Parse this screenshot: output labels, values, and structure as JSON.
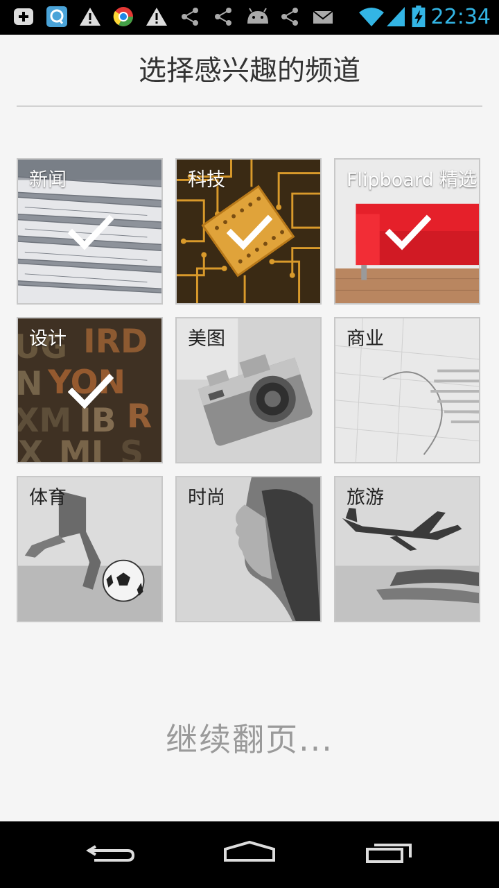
{
  "status_bar": {
    "time": "22:34",
    "icons": [
      "add-box-icon",
      "search-app-icon",
      "warning-icon",
      "chrome-like-icon",
      "warning-icon",
      "share-icon",
      "share-icon",
      "android-icon",
      "share-icon",
      "mail-icon",
      "wifi-icon",
      "signal-icon",
      "battery-charging-icon"
    ]
  },
  "header": {
    "title": "选择感兴趣的频道"
  },
  "channels": [
    {
      "label": "新闻",
      "selected": true
    },
    {
      "label": "科技",
      "selected": true
    },
    {
      "label": "Flipboard 精选",
      "selected": true
    },
    {
      "label": "设计",
      "selected": true
    },
    {
      "label": "美图",
      "selected": false
    },
    {
      "label": "商业",
      "selected": false
    },
    {
      "label": "体育",
      "selected": false
    },
    {
      "label": "时尚",
      "selected": false
    },
    {
      "label": "旅游",
      "selected": false
    }
  ],
  "footer": {
    "more_label": "继续翻页..."
  },
  "nav": {
    "buttons": [
      "back-icon",
      "home-icon",
      "recent-apps-icon"
    ]
  },
  "colors": {
    "time_accent": "#33b5e5",
    "background": "#f5f5f5"
  }
}
